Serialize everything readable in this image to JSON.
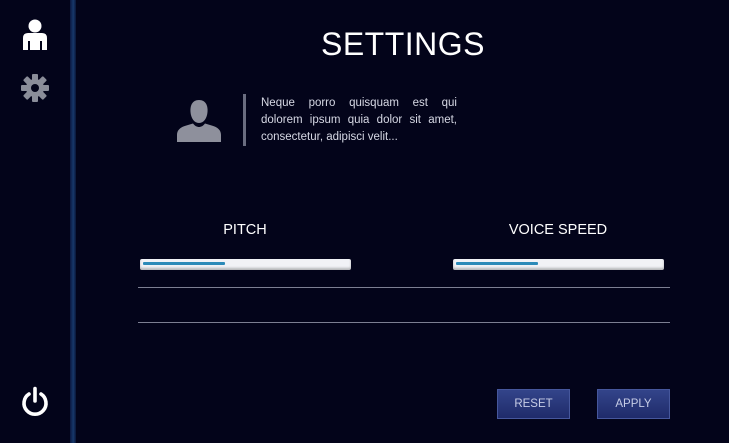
{
  "sidebar": {
    "items": [
      {
        "icon": "user-icon"
      },
      {
        "icon": "gear-icon"
      },
      {
        "icon": "power-icon"
      }
    ]
  },
  "header": {
    "title": "SETTINGS"
  },
  "profile": {
    "avatar_icon": "person-silhouette-icon",
    "bio": "Neque porro quisquam est qui dolorem ipsum quia dolor sit amet, consectetur, adipisci velit..."
  },
  "controls": {
    "pitch": {
      "label": "PITCH",
      "value_fraction": 0.4
    },
    "voice_speed": {
      "label": "VOICE SPEED",
      "value_fraction": 0.4
    }
  },
  "buttons": {
    "reset": "RESET",
    "apply": "APPLY"
  },
  "colors": {
    "background": "#03041a",
    "sidebar_edge": "#17386a",
    "slider_fill": "#2c8ab8",
    "button": "#27357a"
  }
}
